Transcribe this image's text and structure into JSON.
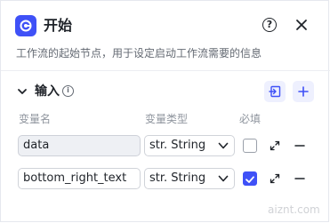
{
  "header": {
    "title": "开始",
    "subtitle": "工作流的起始节点，用于设定启动工作流需要的信息",
    "help_symbol": "?"
  },
  "inputs_section": {
    "title": "输入",
    "info_symbol": "i",
    "columns": {
      "name": "变量名",
      "type": "变量类型",
      "required": "必填"
    },
    "rows": [
      {
        "name": "data",
        "type": "str. String",
        "required": false
      },
      {
        "name": "bottom_right_text",
        "type": "str. String",
        "required": true
      }
    ]
  },
  "watermark": "aiznt.com",
  "colors": {
    "accent": "#3f51f7",
    "accent_soft": "#eef0fe",
    "text": "#1f2329",
    "muted": "#8f959e"
  },
  "icons": [
    "app-logo-icon",
    "help-icon",
    "close-icon",
    "chevron-down-icon",
    "info-icon",
    "import-icon",
    "plus-icon",
    "caret-down-icon",
    "expand-icon",
    "minus-icon",
    "check-icon"
  ]
}
